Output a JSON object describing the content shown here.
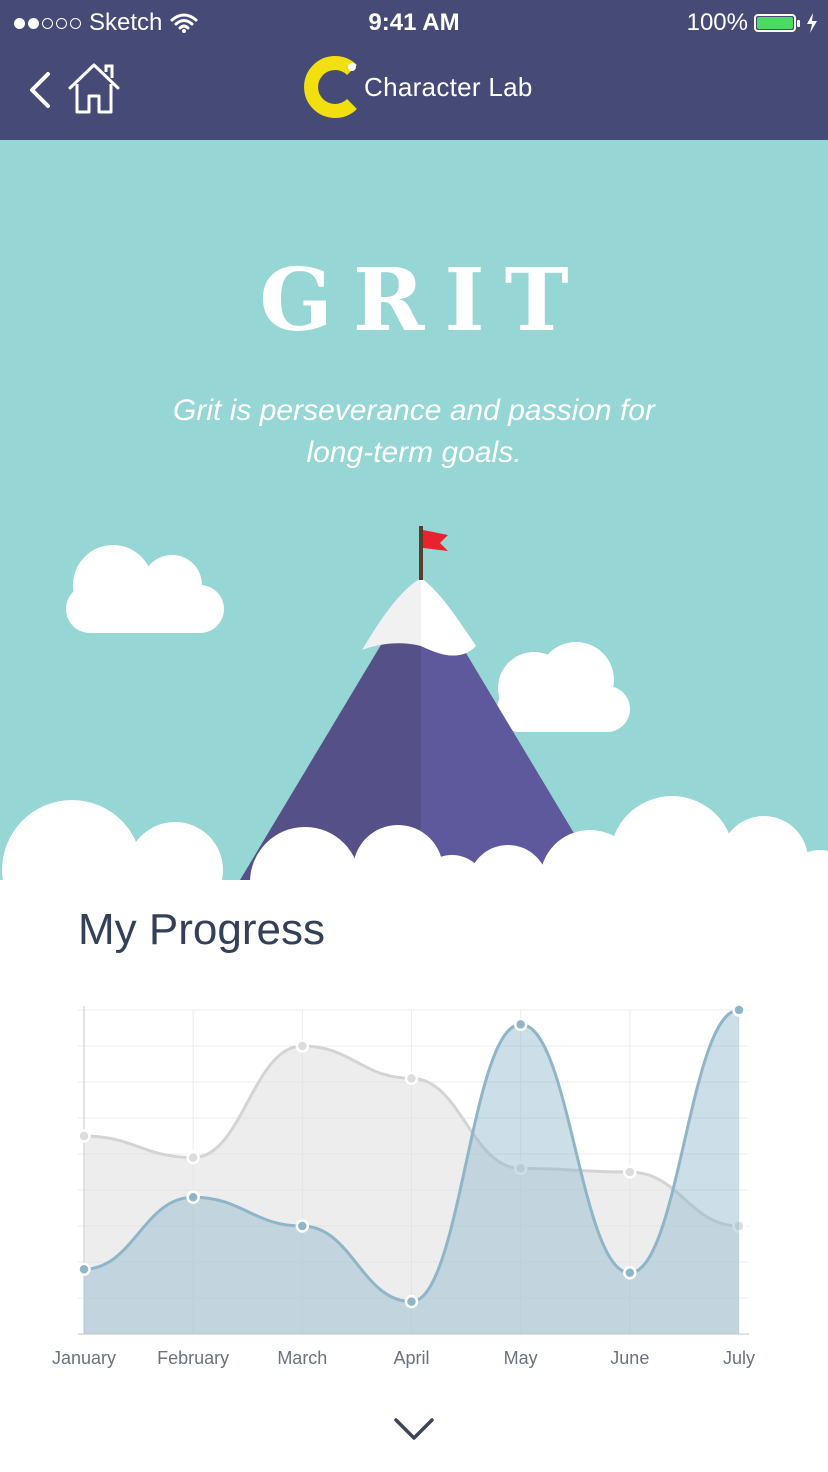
{
  "status_bar": {
    "carrier": "Sketch",
    "time": "9:41 AM",
    "battery": "100%"
  },
  "nav": {
    "brand": "Character Lab",
    "logo_letter": "C"
  },
  "hero": {
    "title": "GRIT",
    "subtitle": "Grit is perseverance and passion for long-term goals."
  },
  "section_title": "My Progress",
  "colors": {
    "nav_bg": "#454a76",
    "hero_bg": "#96d6d5",
    "mountain": "#574f8c",
    "flag": "#e8222e",
    "logo": "#f2e00e",
    "series_gray": "#d4d4d4",
    "series_blue": "#8fb5c9"
  },
  "icons": [
    "back-chevron-icon",
    "home-icon",
    "wifi-icon",
    "battery-icon",
    "charging-bolt-icon",
    "chevron-down-icon"
  ],
  "chart_data": {
    "type": "area",
    "categories": [
      "January",
      "February",
      "March",
      "April",
      "May",
      "June",
      "July"
    ],
    "series": [
      {
        "values": [
          55,
          49,
          80,
          71,
          46,
          45,
          30
        ]
      },
      {
        "values": [
          18,
          38,
          30,
          9,
          86,
          17,
          90
        ]
      }
    ],
    "ylim": [
      0,
      90
    ],
    "grid": true
  }
}
